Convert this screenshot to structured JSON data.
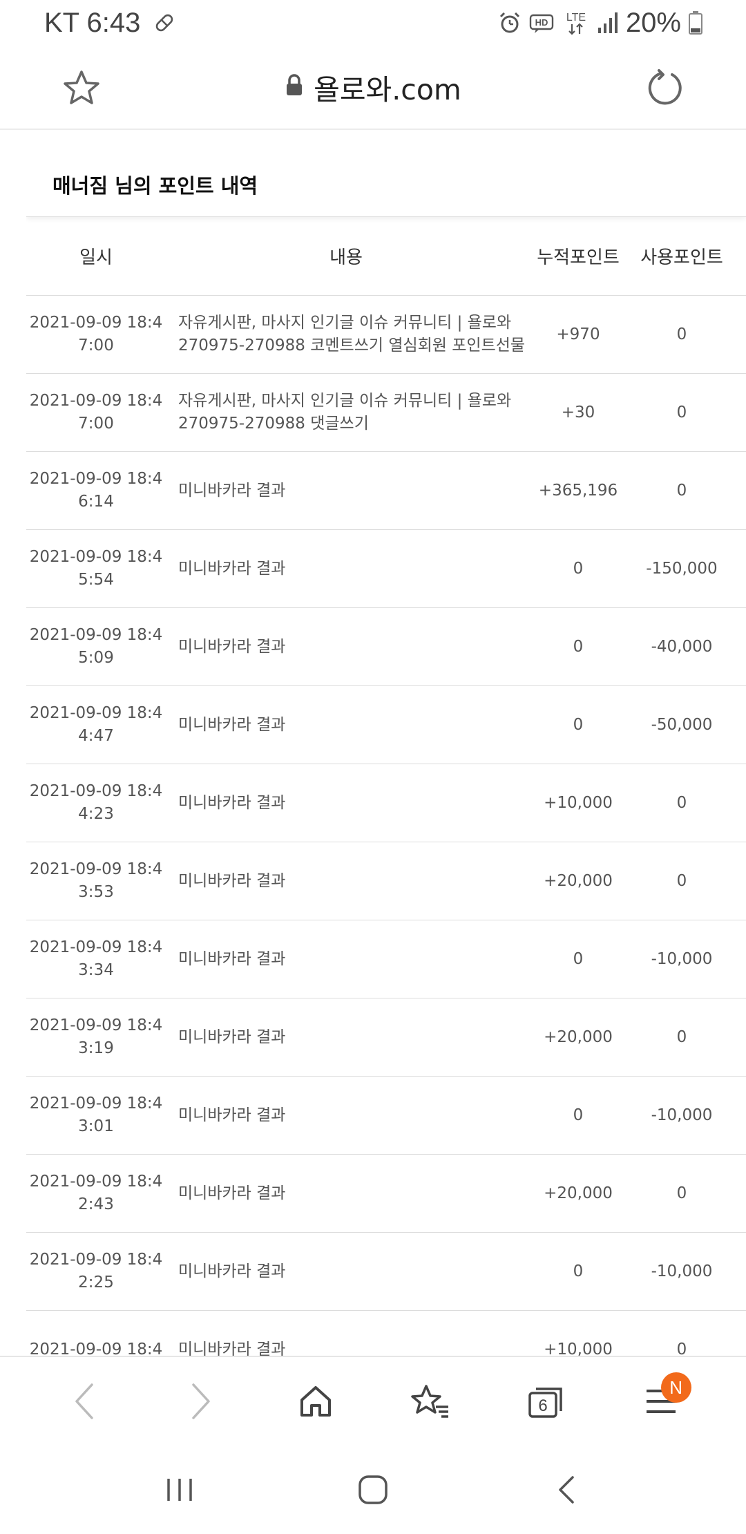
{
  "status_bar": {
    "carrier_time": "KT 6:43",
    "battery": "20%",
    "icons": [
      "pill-icon",
      "alarm-icon",
      "hd-icon",
      "lte-icon",
      "signal-icon",
      "battery-icon"
    ]
  },
  "url_bar": {
    "url": "욜로와.com",
    "icons": [
      "star-icon",
      "lock-icon",
      "refresh-icon"
    ]
  },
  "card": {
    "title": "매너짐 님의 포인트 내역",
    "headers": {
      "date": "일시",
      "content": "내용",
      "accumulated": "누적포인트",
      "used": "사용포인트"
    },
    "rows": [
      {
        "date1": "2021-09-09 18:4",
        "date2": "7:00",
        "desc1": "자유게시판, 마사지 인기글 이슈 커뮤니티 | 욜로와",
        "desc2": "270975-270988 코멘트쓰기 열심회원 포인트선물",
        "acc": "+970",
        "use": "0"
      },
      {
        "date1": "2021-09-09 18:4",
        "date2": "7:00",
        "desc1": "자유게시판, 마사지 인기글 이슈 커뮤니티 | 욜로와",
        "desc2": "270975-270988 댓글쓰기",
        "acc": "+30",
        "use": "0"
      },
      {
        "date1": "2021-09-09 18:4",
        "date2": "6:14",
        "desc1": "미니바카라 결과",
        "desc2": "",
        "acc": "+365,196",
        "use": "0"
      },
      {
        "date1": "2021-09-09 18:4",
        "date2": "5:54",
        "desc1": "미니바카라 결과",
        "desc2": "",
        "acc": "0",
        "use": "-150,000"
      },
      {
        "date1": "2021-09-09 18:4",
        "date2": "5:09",
        "desc1": "미니바카라 결과",
        "desc2": "",
        "acc": "0",
        "use": "-40,000"
      },
      {
        "date1": "2021-09-09 18:4",
        "date2": "4:47",
        "desc1": "미니바카라 결과",
        "desc2": "",
        "acc": "0",
        "use": "-50,000"
      },
      {
        "date1": "2021-09-09 18:4",
        "date2": "4:23",
        "desc1": "미니바카라 결과",
        "desc2": "",
        "acc": "+10,000",
        "use": "0"
      },
      {
        "date1": "2021-09-09 18:4",
        "date2": "3:53",
        "desc1": "미니바카라 결과",
        "desc2": "",
        "acc": "+20,000",
        "use": "0"
      },
      {
        "date1": "2021-09-09 18:4",
        "date2": "3:34",
        "desc1": "미니바카라 결과",
        "desc2": "",
        "acc": "0",
        "use": "-10,000"
      },
      {
        "date1": "2021-09-09 18:4",
        "date2": "3:19",
        "desc1": "미니바카라 결과",
        "desc2": "",
        "acc": "+20,000",
        "use": "0"
      },
      {
        "date1": "2021-09-09 18:4",
        "date2": "3:01",
        "desc1": "미니바카라 결과",
        "desc2": "",
        "acc": "0",
        "use": "-10,000"
      },
      {
        "date1": "2021-09-09 18:4",
        "date2": "2:43",
        "desc1": "미니바카라 결과",
        "desc2": "",
        "acc": "+20,000",
        "use": "0"
      },
      {
        "date1": "2021-09-09 18:4",
        "date2": "2:25",
        "desc1": "미니바카라 결과",
        "desc2": "",
        "acc": "0",
        "use": "-10,000"
      },
      {
        "date1": "2021-09-09 18:4",
        "date2": "",
        "desc1": "미니바카라 결과",
        "desc2": "",
        "acc": "+10,000",
        "use": "0"
      }
    ]
  },
  "toolbar": {
    "tab_count": "6",
    "badge": "N",
    "badge_color": "#f26a1b",
    "icons": [
      "back-icon",
      "forward-icon",
      "home-icon",
      "bookmarks-icon",
      "tabs-icon",
      "menu-icon"
    ]
  },
  "navbar": {
    "icons": [
      "recents-icon",
      "home-nav-icon",
      "back-nav-icon"
    ]
  }
}
